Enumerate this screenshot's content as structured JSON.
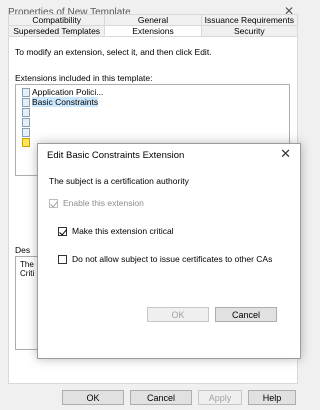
{
  "window": {
    "title": "Properties of New Template"
  },
  "tabs": {
    "row1": [
      "Compatibility",
      "General",
      "Issuance Requirements"
    ],
    "row2": [
      "Superseded Templates",
      "Extensions",
      "Security"
    ],
    "active": "Extensions"
  },
  "extensions_tab": {
    "instructions": "To modify an extension, select it, and then click Edit.",
    "list_label": "Extensions included in this template:",
    "items": [
      {
        "label": "Application Polici...",
        "icon": "certificate-icon"
      },
      {
        "label": "Basic Constraints",
        "icon": "certificate-icon",
        "selected": true
      },
      {
        "label": "",
        "icon": "certificate-icon"
      },
      {
        "label": "",
        "icon": "certificate-icon"
      },
      {
        "label": "",
        "icon": "certificate-icon"
      },
      {
        "label": "",
        "icon": "warning-certificate-icon"
      }
    ],
    "description_label": "Des",
    "description_text": "The\nCriti"
  },
  "dialog": {
    "title": "Edit Basic Constraints Extension",
    "subject_text": "The subject is a certification authority",
    "enable_extension": {
      "label": "Enable this extension",
      "checked": true,
      "enabled": false
    },
    "make_critical": {
      "label": "Make this extension critical",
      "checked": true,
      "enabled": true
    },
    "no_issue": {
      "label": "Do not allow subject to issue certificates to other CAs",
      "checked": false,
      "enabled": true
    },
    "ok_label": "OK",
    "cancel_label": "Cancel"
  },
  "footer": {
    "ok_label": "OK",
    "cancel_label": "Cancel",
    "apply_label": "Apply",
    "help_label": "Help"
  }
}
